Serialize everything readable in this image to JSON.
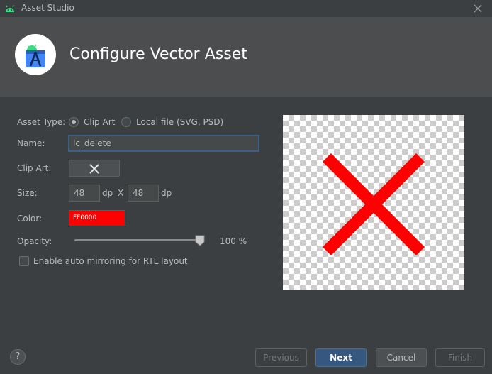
{
  "window": {
    "title": "Asset Studio",
    "close_icon": "close-icon"
  },
  "header": {
    "title": "Configure Vector Asset",
    "logo": "android-studio-logo"
  },
  "form": {
    "asset_type_label": "Asset Type:",
    "asset_type_options": [
      {
        "label": "Clip Art",
        "selected": true
      },
      {
        "label": "Local file (SVG, PSD)",
        "selected": false
      }
    ],
    "name_label": "Name:",
    "name_value": "ic_delete",
    "clip_art_label": "Clip Art:",
    "clip_art_icon": "close-icon",
    "size_label": "Size:",
    "width_value": "48",
    "width_unit": "dp",
    "size_separator": "X",
    "height_value": "48",
    "height_unit": "dp",
    "color_label": "Color:",
    "color_value": "FF0000",
    "color_hex": "#ff0000",
    "opacity_label": "Opacity:",
    "opacity_value": 100,
    "opacity_text": "100 %",
    "rtl_label": "Enable auto mirroring for RTL layout",
    "rtl_checked": false
  },
  "preview": {
    "icon": "close-icon",
    "color": "#ff0000"
  },
  "footer": {
    "help": "?",
    "previous": "Previous",
    "next": "Next",
    "cancel": "Cancel",
    "finish": "Finish"
  }
}
